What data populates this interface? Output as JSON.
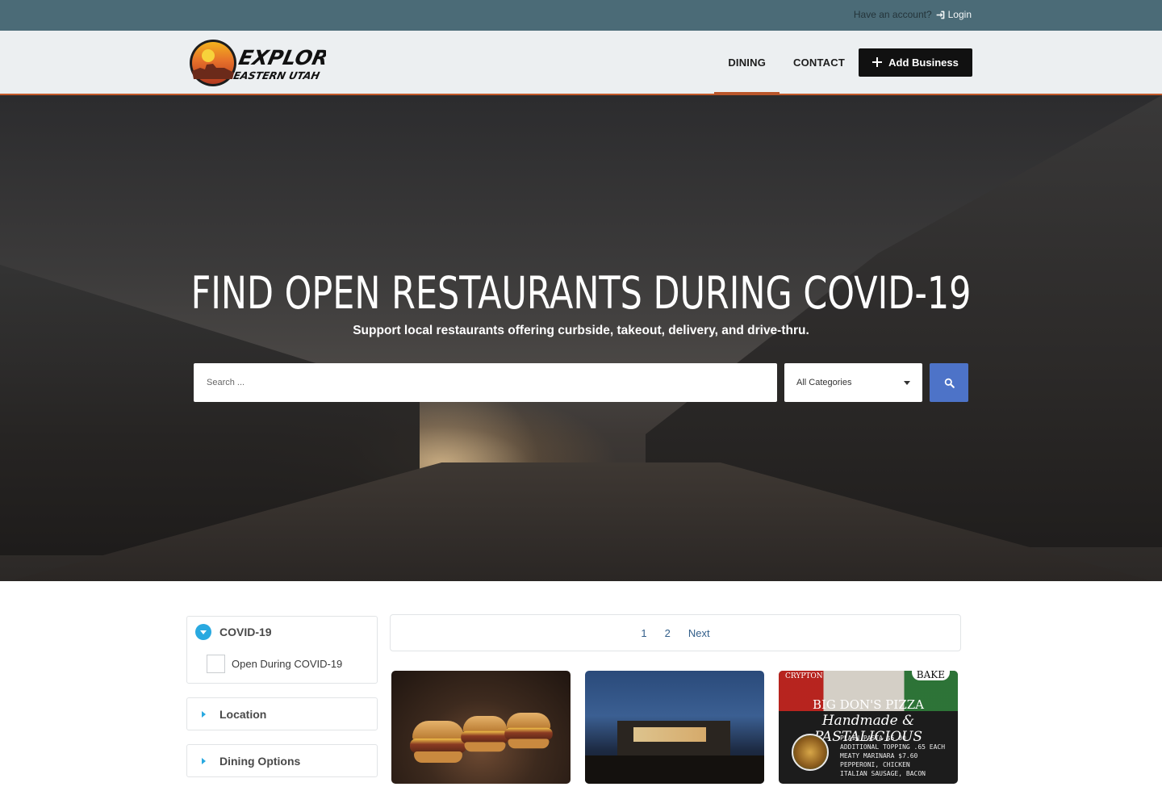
{
  "topbar": {
    "account_prompt": "Have an account?",
    "login_label": "Login"
  },
  "header": {
    "logo_text_line1": "EXPLORE",
    "logo_text_line2": "EASTERN UTAH",
    "nav": [
      {
        "label": "DINING",
        "active": true
      },
      {
        "label": "CONTACT",
        "active": false
      }
    ],
    "add_business_label": "Add Business"
  },
  "hero": {
    "title": "FIND OPEN RESTAURANTS DURING COVID-19",
    "subtitle": "Support local restaurants offering curbside, takeout, delivery, and drive-thru.",
    "search_placeholder": "Search ...",
    "category_selected": "All Categories"
  },
  "filters": {
    "covid": {
      "title": "COVID-19",
      "option": "Open During COVID-19",
      "checked": false,
      "expanded": true
    },
    "location": {
      "title": "Location",
      "expanded": false
    },
    "dining_options": {
      "title": "Dining Options",
      "expanded": false
    }
  },
  "pagination": {
    "pages": [
      "1",
      "2"
    ],
    "next_label": "Next"
  },
  "cards": {
    "card3": {
      "corner_left": "CRYPTON",
      "corner_right": "BAKE",
      "title": "BIG DON'S PIZZA",
      "tagline": "Handmade & PASTALICIOUS",
      "menu_line1": "PLAIN PASTA $5.00",
      "menu_line2": "ADDITIONAL TOPPING .65 EACH",
      "menu_line3": "MEATY MARINARA $7.60",
      "menu_line4": "PEPPERONI, CHICKEN",
      "menu_line5": "ITALIAN SAUSAGE, BACON"
    }
  },
  "colors": {
    "topbar": "#4b6b77",
    "header_bg": "#eceff1",
    "nav_accent": "#b9562b",
    "search_button": "#4d73c8",
    "filter_accent": "#29a9e0",
    "link": "#335f8a"
  },
  "icons": {
    "login": "sign-in-icon",
    "add": "plus-icon",
    "search": "search-icon",
    "expand": "chevron-down-icon",
    "collapsed": "caret-right-icon"
  }
}
